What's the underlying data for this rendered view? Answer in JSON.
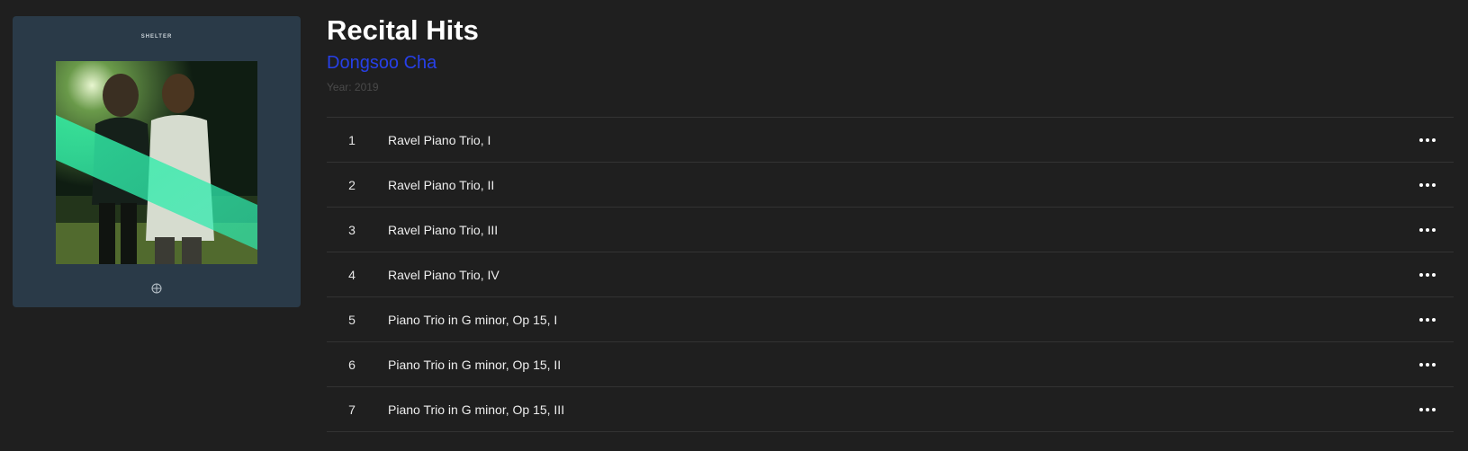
{
  "album": {
    "title": "Recital Hits",
    "artist": "Dongsoo Cha",
    "year": "Year: 2019",
    "cover": {
      "label": "SHELTER",
      "background_color": "#2a3a48"
    }
  },
  "colors": {
    "background": "#1f1f1f",
    "artist_link": "#2740e8",
    "divider": "#333333"
  },
  "tracks": [
    {
      "number": "1",
      "title": "Ravel Piano Trio, I",
      "menu_icon": "more-icon"
    },
    {
      "number": "2",
      "title": "Ravel Piano Trio, II",
      "menu_icon": "more-icon"
    },
    {
      "number": "3",
      "title": "Ravel Piano Trio, III",
      "menu_icon": "more-icon"
    },
    {
      "number": "4",
      "title": "Ravel Piano Trio, IV",
      "menu_icon": "more-icon"
    },
    {
      "number": "5",
      "title": "Piano Trio in G minor, Op 15, I",
      "menu_icon": "more-icon"
    },
    {
      "number": "6",
      "title": "Piano Trio in G minor, Op 15, II",
      "menu_icon": "more-icon"
    },
    {
      "number": "7",
      "title": "Piano Trio in G minor, Op 15, III",
      "menu_icon": "more-icon"
    }
  ]
}
